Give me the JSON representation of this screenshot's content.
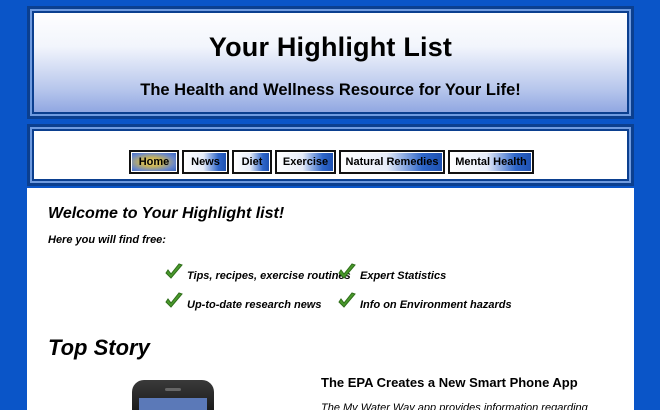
{
  "header": {
    "title": "Your Highlight List",
    "tagline": "The Health and Wellness Resource for Your Life!"
  },
  "nav": {
    "items": [
      {
        "label": "Home",
        "active": true
      },
      {
        "label": "News",
        "active": false
      },
      {
        "label": "Diet",
        "active": false
      },
      {
        "label": "Exercise",
        "active": false
      },
      {
        "label": "Natural Remedies",
        "active": false
      },
      {
        "label": "Mental Health",
        "active": false
      }
    ]
  },
  "main": {
    "welcome": "Welcome to Your Highlight list!",
    "intro": "Here you will find free:",
    "features": [
      "Tips, recipes, exercise routines",
      "Expert Statistics",
      "Up-to-date research news",
      "Info on Environment hazards"
    ],
    "top_story_heading": "Top Story",
    "story": {
      "title": "The EPA Creates a New Smart Phone App",
      "text": "The My Water Way app provides information regarding"
    }
  },
  "colors": {
    "page_background": "#0a55c8",
    "frame_border": "#0b3f8f",
    "checkmark": "#4a9a2c"
  }
}
